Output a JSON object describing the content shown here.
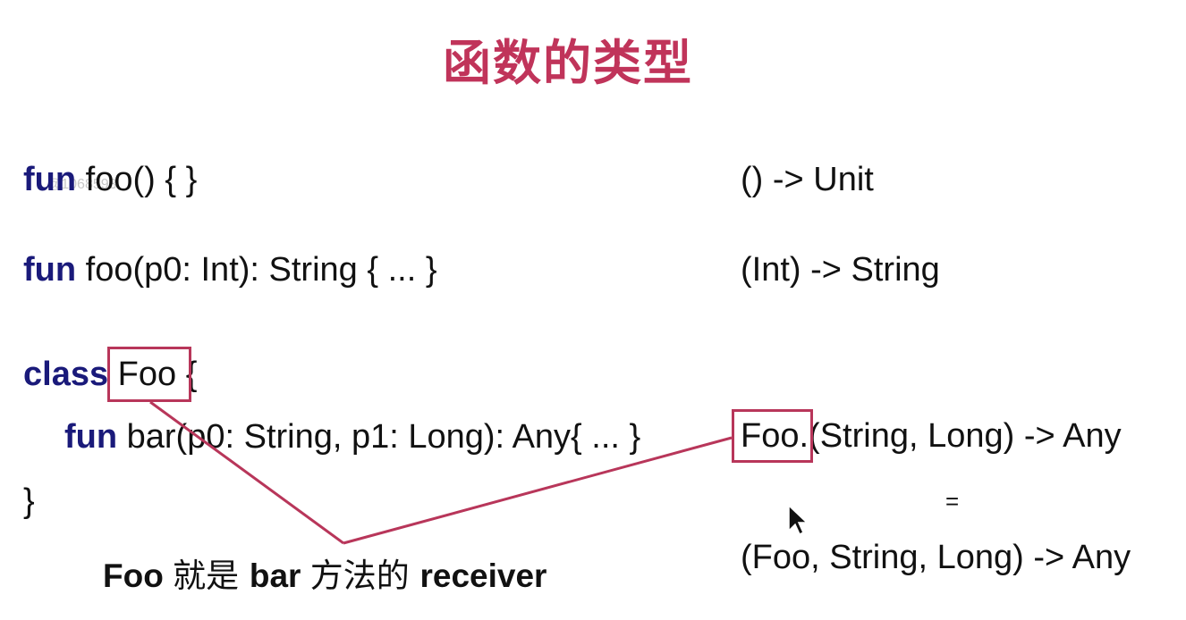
{
  "slide": {
    "title": "函数的类型",
    "watermark": "@1068593",
    "code": {
      "line1_kw": "fun",
      "line1_rest": " foo() { }",
      "line2_kw": "fun",
      "line2_rest": " foo(p0: Int): String { ... }",
      "line3_kw": "class",
      "line3_class": "Foo",
      "line3_rest": " {",
      "line4_kw": "fun",
      "line4_rest": " bar(p0: String, p1: Long): Any{ ... }",
      "line5": "}"
    },
    "types": {
      "type1": "() -> Unit",
      "type2": "(Int) -> String",
      "type3_receiver": "Foo.",
      "type3_rest": "(String, Long) -> Any",
      "equals": "=",
      "type4": "(Foo, String, Long) -> Any"
    },
    "note": {
      "part1": "Foo ",
      "part2": "就是 ",
      "part3": "bar ",
      "part4": "方法的 ",
      "part5": "receiver"
    },
    "colors": {
      "title": "#c0345a",
      "keyword": "#1a1a7a",
      "highlight": "#b8365a"
    }
  }
}
